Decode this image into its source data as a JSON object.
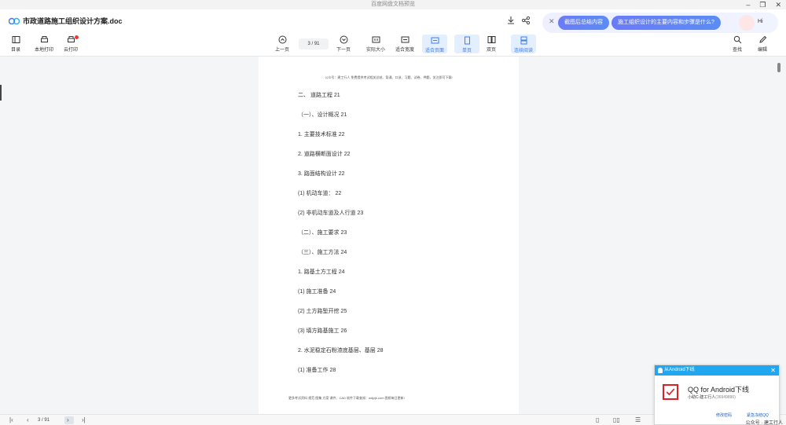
{
  "app": {
    "window_title": "百度网盘文档预览",
    "doc_title": "市政道路施工组织设计方案.doc"
  },
  "ai": {
    "chip1": "截图后总结内容",
    "chip2": "施工组织设计的主要内容和步骤是什么?",
    "hi": "Hi"
  },
  "toolbar": {
    "menu": "目录",
    "local_print": "本地打印",
    "cloud_print": "云打印",
    "prev": "上一页",
    "page_indicator": "3 / 91",
    "next": "下一页",
    "actual_size": "实际大小",
    "fit_width": "适合宽度",
    "fit_page": "适合页面",
    "single": "单页",
    "double": "双页",
    "continuous": "连续阅读",
    "find": "查找",
    "edit": "编辑"
  },
  "document": {
    "header": "公众号：建工行人 免费提供考试相关总结、背诵、口诀、习题、试卷、押题，关注即可下载!",
    "toc": [
      "二、 道路工程 21",
      "（一）、设计概况 21",
      "1. 主要技术标准 22",
      "2. 道路横断面设计 22",
      "3. 路面结构设计 22",
      "(1) 机动车道： 22",
      "(2) 非机动车道及人行道 23",
      "（二）、施工要求 23",
      "（三）、施工方法 24",
      "1. 路基土方工程 24",
      "(1) 施工准备 24",
      "(2) 土方路堑开挖 25",
      "(3) 填方路基施工 26",
      "2. 水泥稳定石粉渣底基层、基层 28",
      "(1) 准备工作 28"
    ],
    "footer": "更多考试资料 规范 图集 方案 课件、CAD 软件下载查阅：wdjzjk.com 图纸每日更新!"
  },
  "statusbar": {
    "page": "3 / 91"
  },
  "notification": {
    "header": "从Android下线",
    "title": "QQ for Android下线",
    "sub_name": "小助C-建工行人",
    "sub_id": "(36949890)",
    "link1": "修改密码",
    "link2": "紧急冻结QQ",
    "watermark": "公众号 · 建工行人"
  }
}
